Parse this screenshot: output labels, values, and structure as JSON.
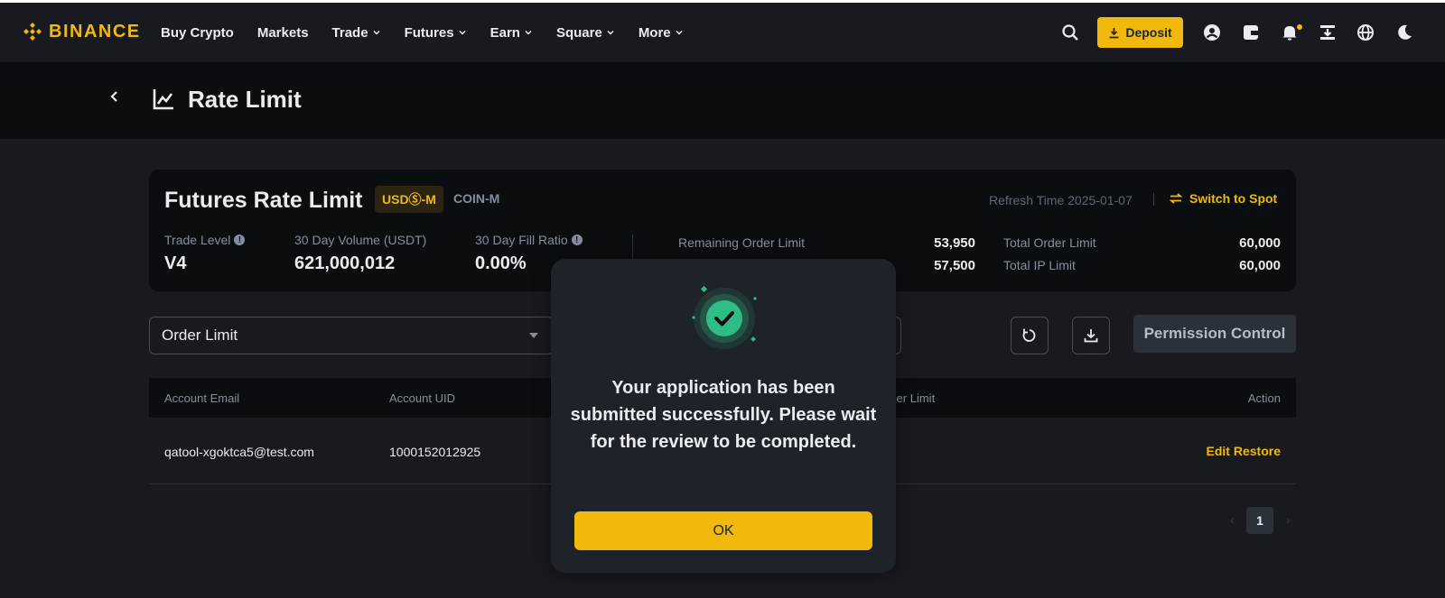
{
  "brand": {
    "name": "BINANCE",
    "accent": "#f0b90b"
  },
  "nav": {
    "links": [
      {
        "label": "Buy Crypto",
        "dropdown": false
      },
      {
        "label": "Markets",
        "dropdown": false
      },
      {
        "label": "Trade",
        "dropdown": true
      },
      {
        "label": "Futures",
        "dropdown": true
      },
      {
        "label": "Earn",
        "dropdown": true
      },
      {
        "label": "Square",
        "dropdown": true
      },
      {
        "label": "More",
        "dropdown": true
      }
    ],
    "deposit_label": "Deposit",
    "icons": [
      "search-icon",
      "download-icon",
      "user-icon",
      "wallet-icon",
      "bell-icon",
      "qr-download-icon",
      "globe-icon",
      "moon-icon"
    ]
  },
  "header": {
    "title": "Rate Limit",
    "back_icon": "chevron-left-icon",
    "title_icon": "chart-icon"
  },
  "card": {
    "title": "Futures Rate Limit",
    "tabs": [
      "USDⓈ-M",
      "COIN-M"
    ],
    "refresh_time": "Refresh Time 2025-01-07",
    "switch_label": "Switch to Spot",
    "stats": [
      {
        "label": "Trade Level",
        "value": "V4",
        "info": true
      },
      {
        "label": "30 Day Volume (USDT)",
        "value": "621,000,012",
        "info": false
      },
      {
        "label": "30 Day Fill Ratio",
        "value": "0.00%",
        "info": true
      }
    ],
    "limits": {
      "remaining_order_label": "Remaining Order Limit",
      "remaining_order_value": "53,950",
      "remaining_ip_value": "57,500",
      "total_order_label": "Total Order Limit",
      "total_order_value": "60,000",
      "total_ip_label": "Total IP Limit",
      "total_ip_value": "60,000"
    }
  },
  "controls": {
    "select_value": "Order Limit",
    "permission_label": "Permission Control"
  },
  "table": {
    "headers": {
      "email": "Account Email",
      "uid": "Account UID",
      "order_limit": "rder Limit",
      "action": "Action"
    },
    "rows": [
      {
        "email": "qatool-xgoktca5@test.com",
        "uid": "1000152012925",
        "action": "Edit Restore"
      }
    ]
  },
  "pagination": {
    "current": "1",
    "prev": "‹",
    "next": "›"
  },
  "modal": {
    "message": "Your application has been submitted successfully. Please wait for the review to be completed.",
    "ok_label": "OK",
    "success_color": "#2ebd85"
  }
}
